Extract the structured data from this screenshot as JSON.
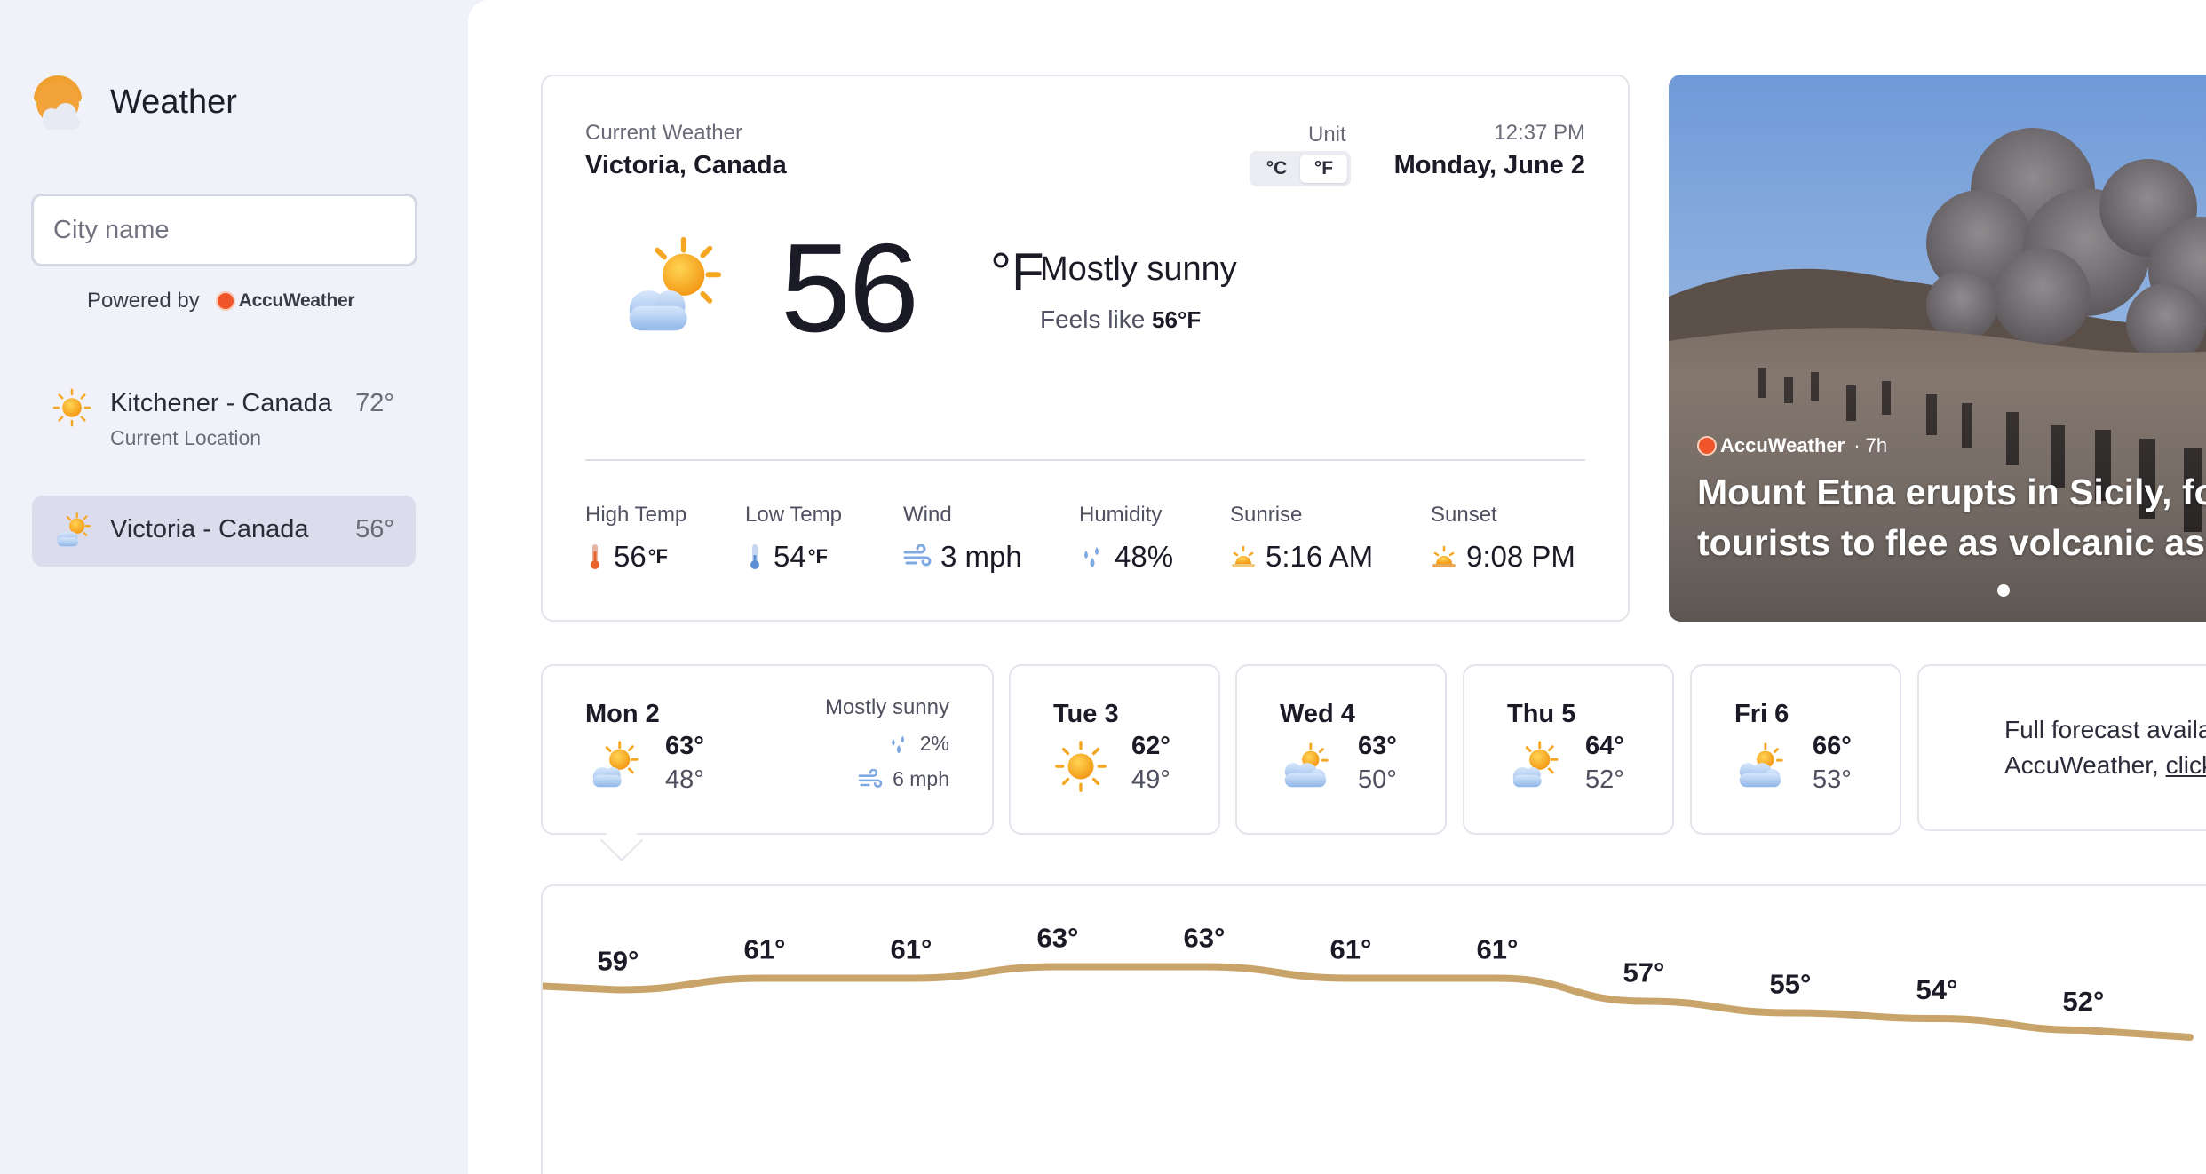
{
  "app": {
    "title": "Weather"
  },
  "search": {
    "placeholder": "City name"
  },
  "powered": {
    "label": "Powered by",
    "brand": "AccuWeather"
  },
  "locations": [
    {
      "name": "Kitchener - Canada",
      "temp": "72°",
      "sub": "Current Location",
      "icon": "sun-icon"
    },
    {
      "name": "Victoria - Canada",
      "temp": "56°",
      "icon": "partly-sunny-icon",
      "selected": true
    }
  ],
  "current": {
    "label": "Current Weather",
    "city": "Victoria, Canada",
    "unit_label": "Unit",
    "unit_c": "°C",
    "unit_f": "°F",
    "selected_unit": "°F",
    "time": "12:37 PM",
    "date": "Monday, June 2",
    "temp": "56",
    "temp_unit": "°F",
    "condition": "Mostly sunny",
    "feels_label": "Feels like",
    "feels_value": "56",
    "feels_unit": "°F",
    "stats": {
      "high": {
        "label": "High Temp",
        "value": "56",
        "unit": "°F"
      },
      "low": {
        "label": "Low Temp",
        "value": "54",
        "unit": "°F"
      },
      "wind": {
        "label": "Wind",
        "value": "3 mph"
      },
      "humidity": {
        "label": "Humidity",
        "value": "48%"
      },
      "sunrise": {
        "label": "Sunrise",
        "value": "5:16 AM"
      },
      "sunset": {
        "label": "Sunset",
        "value": "9:08 PM"
      }
    }
  },
  "news": {
    "source": "AccuWeather",
    "age": "· 7h",
    "headline": "Mount Etna erupts in Sicily, forcing tourists to flee as volcanic ash"
  },
  "daily": [
    {
      "day": "Mon 2",
      "hi": "63°",
      "lo": "48°",
      "condition": "Mostly sunny",
      "precip": "2%",
      "wind": "6 mph",
      "icon": "partly-sunny-icon"
    },
    {
      "day": "Tue 3",
      "hi": "62°",
      "lo": "49°",
      "icon": "sun-icon"
    },
    {
      "day": "Wed 4",
      "hi": "63°",
      "lo": "50°",
      "icon": "cloudy-sun-icon"
    },
    {
      "day": "Thu 5",
      "hi": "64°",
      "lo": "52°",
      "icon": "partly-sunny-icon"
    },
    {
      "day": "Fri 6",
      "hi": "66°",
      "lo": "53°",
      "icon": "cloudy-sun-icon"
    }
  ],
  "full_forecast": {
    "line1": "Full forecast available at",
    "line2_prefix": "AccuWeather, ",
    "link": "click here"
  },
  "hourly": {
    "temps": [
      59,
      61,
      61,
      63,
      63,
      61,
      61,
      57,
      55,
      54,
      52
    ],
    "labels": [
      "59°",
      "61°",
      "61°",
      "63°",
      "63°",
      "61°",
      "61°",
      "57°",
      "55°",
      "54°",
      "52°"
    ],
    "line_color": "#c9a46a"
  },
  "colors": {
    "sidebar_bg": "#f1f2f9",
    "selected_bg": "#dcdcec",
    "sun": "#f7b32b",
    "cloud": "#a9c8ee"
  }
}
